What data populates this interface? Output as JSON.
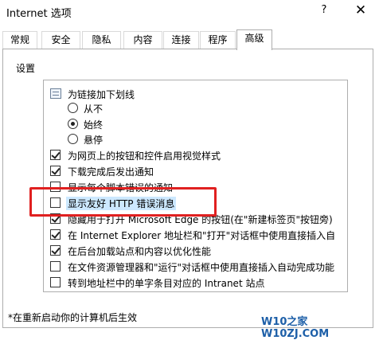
{
  "window": {
    "title": "Internet 选项",
    "help_label": "?",
    "close_label": "✕"
  },
  "tabs": [
    {
      "label": "常规",
      "active": false
    },
    {
      "label": "安全",
      "active": false
    },
    {
      "label": "隐私",
      "active": false
    },
    {
      "label": "内容",
      "active": false
    },
    {
      "label": "连接",
      "active": false
    },
    {
      "label": "程序",
      "active": false
    },
    {
      "label": "高级",
      "active": true
    }
  ],
  "settings": {
    "group_label": "设置",
    "items": [
      {
        "kind": "folder",
        "label": "为链接加下划线"
      },
      {
        "kind": "radio",
        "label": "从不",
        "selected": false
      },
      {
        "kind": "radio",
        "label": "始终",
        "selected": true
      },
      {
        "kind": "radio",
        "label": "悬停",
        "selected": false
      },
      {
        "kind": "checkbox",
        "label": "为网页上的按钮和控件启用视觉样式",
        "checked": true
      },
      {
        "kind": "checkbox",
        "label": "下载完成后发出通知",
        "checked": true
      },
      {
        "kind": "checkbox",
        "label": "显示每个脚本错误的通知",
        "checked": false
      },
      {
        "kind": "checkbox",
        "label": "显示友好 HTTP 错误消息",
        "checked": false,
        "highlighted": true
      },
      {
        "kind": "checkbox",
        "label": "隐藏用于打开 Microsoft Edge 的按钮(在\"新建标签页\"按钮旁)",
        "checked": true
      },
      {
        "kind": "checkbox",
        "label": "在 Internet Explorer 地址栏和\"打开\"对话框中使用直接插入自",
        "checked": true
      },
      {
        "kind": "checkbox",
        "label": "在后台加载站点和内容以优化性能",
        "checked": true
      },
      {
        "kind": "checkbox",
        "label": "在文件资源管理器和\"运行\"对话框中使用直接插入自动完成功能",
        "checked": false
      },
      {
        "kind": "checkbox",
        "label": "转到地址栏中的单字条目对应的 Intranet 站点",
        "checked": false
      }
    ]
  },
  "footer_note": "*在重新启动你的计算机后生效",
  "watermark": "W10之家 W10ZJ.COM"
}
